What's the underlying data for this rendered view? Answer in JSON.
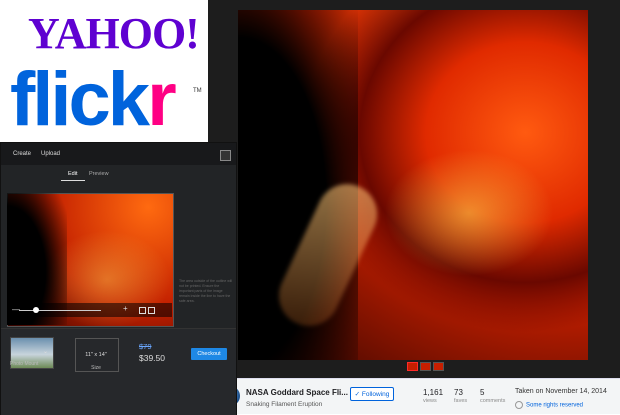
{
  "logos": {
    "yahoo": "YAHOO!",
    "flickr_blue": "flick",
    "flickr_pink": "r",
    "trademark": "TM"
  },
  "colors": {
    "yahoo_purple": "#5f01d1",
    "flickr_blue": "#0063dc",
    "flickr_pink": "#ff0084",
    "checkout_blue": "#1e88e5"
  },
  "editor": {
    "nav": {
      "create": "Create",
      "upload": "Upload"
    },
    "tabs": {
      "edit": "Edit",
      "preview": "Preview"
    },
    "controls": {
      "zoom_out": "—",
      "zoom_in": "+"
    },
    "side_note": "The area outside of the outline will not be printed. Ensure the important parts of the image remain inside the line to have the safe area.",
    "product": {
      "mount_label": "Photo Mount",
      "mount_dropdown": "⌄",
      "size_value": "11\" x 14\"",
      "size_label": "Size",
      "price_old": "$79",
      "price_new": "$39.50",
      "checkout_label": "Checkout"
    }
  },
  "photo_page": {
    "owner": "NASA Goddard Space Fli...",
    "title": "Snaking Filament Eruption",
    "follow_label": "✓ Following",
    "stats": [
      {
        "value": "1,161",
        "label": "views"
      },
      {
        "value": "73",
        "label": "faves"
      },
      {
        "value": "5",
        "label": "comments"
      }
    ],
    "taken": "Taken on November 14, 2014",
    "rights": "Some rights reserved"
  }
}
